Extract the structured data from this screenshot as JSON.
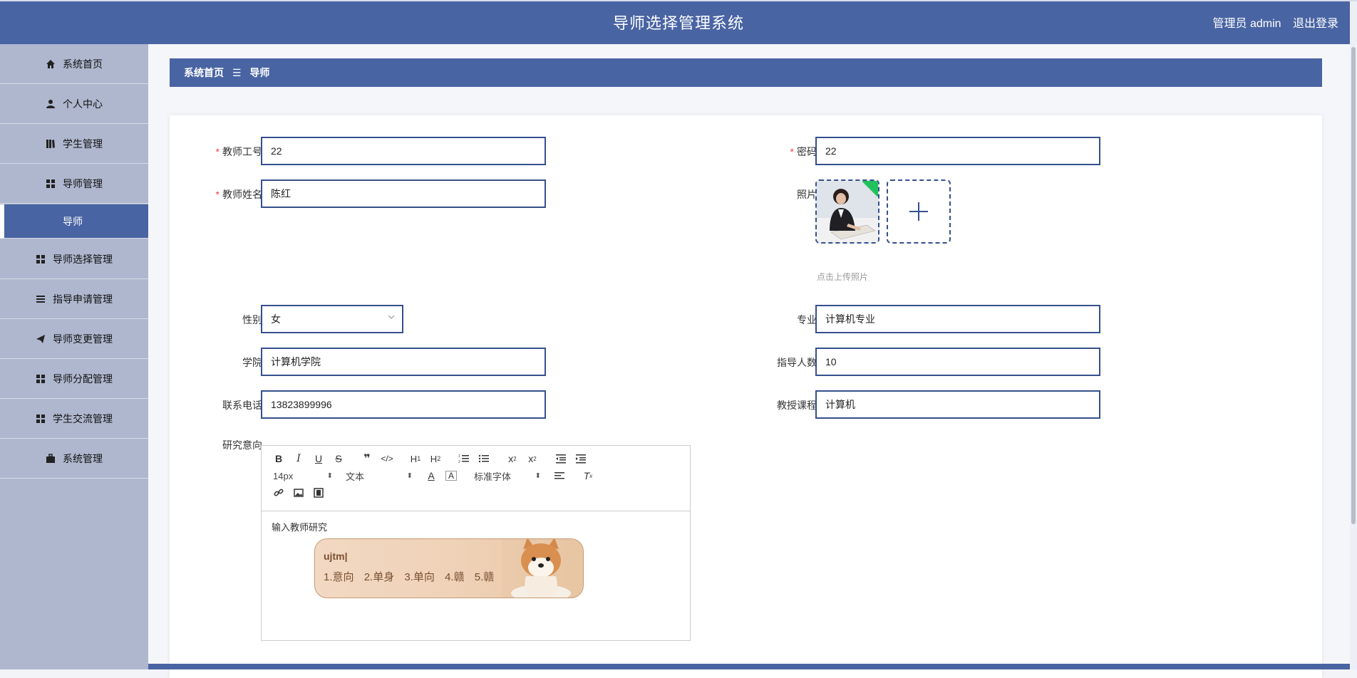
{
  "header": {
    "title": "导师选择管理系统",
    "user_label": "管理员 admin",
    "logout": "退出登录"
  },
  "sidebar": {
    "items": [
      {
        "label": "系统首页",
        "icon": "home-icon"
      },
      {
        "label": "个人中心",
        "icon": "user-icon"
      },
      {
        "label": "学生管理",
        "icon": "book-icon"
      },
      {
        "label": "导师管理",
        "icon": "grid-icon"
      },
      {
        "label": "导师",
        "icon": "",
        "sub": true
      },
      {
        "label": "导师选择管理",
        "icon": "grid-icon"
      },
      {
        "label": "指导申请管理",
        "icon": "list-icon"
      },
      {
        "label": "导师变更管理",
        "icon": "send-icon"
      },
      {
        "label": "导师分配管理",
        "icon": "grid-icon"
      },
      {
        "label": "学生交流管理",
        "icon": "grid-icon"
      },
      {
        "label": "系统管理",
        "icon": "briefcase-icon"
      }
    ]
  },
  "breadcrumb": {
    "home": "系统首页",
    "sep": "☰",
    "current": "导师"
  },
  "form": {
    "teacher_id": {
      "label": "教师工号",
      "value": "22"
    },
    "password": {
      "label": "密码",
      "value": "22"
    },
    "teacher_name": {
      "label": "教师姓名",
      "value": "陈红"
    },
    "photo": {
      "label": "照片",
      "hint": "点击上传照片"
    },
    "gender": {
      "label": "性别",
      "value": "女"
    },
    "major": {
      "label": "专业",
      "value": "计算机专业"
    },
    "college": {
      "label": "学院",
      "value": "计算机学院"
    },
    "guide_count": {
      "label": "指导人数",
      "value": "10"
    },
    "phone": {
      "label": "联系电话",
      "value": "13823899996"
    },
    "course": {
      "label": "教授课程",
      "value": "计算机"
    },
    "research": {
      "label": "研究意向",
      "placeholder": "输入教师研究"
    }
  },
  "editor": {
    "font_size": "14px",
    "text_style": "文本",
    "font_family": "标准字体"
  },
  "ime": {
    "typed": "ujtm",
    "candidates": [
      "1.意向",
      "2.单身",
      "3.单向",
      "4.赣",
      "5.赣"
    ]
  }
}
